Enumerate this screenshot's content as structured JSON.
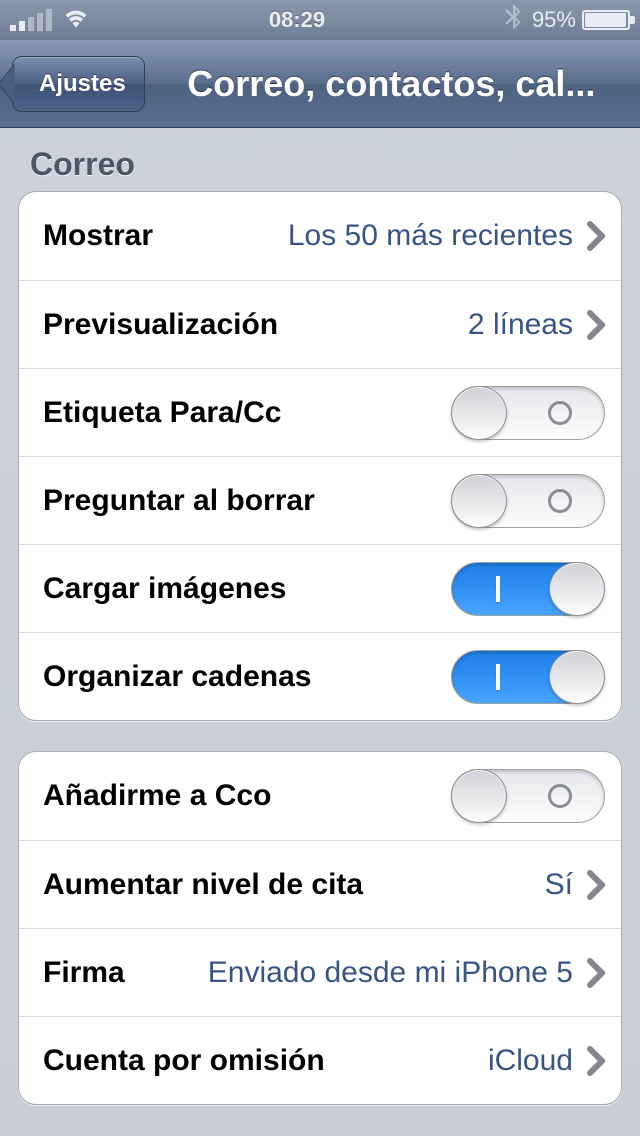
{
  "status": {
    "time": "08:29",
    "battery_pct": "95%"
  },
  "nav": {
    "back_label": "Ajustes",
    "title": "Correo, contactos, cal..."
  },
  "section_mail": "Correo",
  "group1": {
    "show": {
      "label": "Mostrar",
      "value": "Los 50 más recientes"
    },
    "preview": {
      "label": "Previsualización",
      "value": "2 líneas"
    },
    "tocc": {
      "label": "Etiqueta Para/Cc",
      "on": false
    },
    "askdelete": {
      "label": "Preguntar al borrar",
      "on": false
    },
    "loadimg": {
      "label": "Cargar imágenes",
      "on": true
    },
    "threads": {
      "label": "Organizar cadenas",
      "on": true
    }
  },
  "group2": {
    "bcc": {
      "label": "Añadirme a Cco",
      "on": false
    },
    "quote": {
      "label": "Aumentar nivel de cita",
      "value": "Sí"
    },
    "signature": {
      "label": "Firma",
      "value": "Enviado desde mi iPhone 5"
    },
    "default": {
      "label": "Cuenta por omisión",
      "value": "iCloud"
    }
  }
}
